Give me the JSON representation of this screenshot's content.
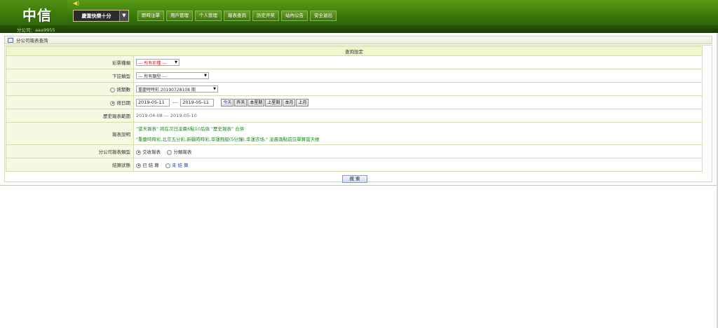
{
  "header": {
    "logo": "中信",
    "lottery_selector": "慶重快樂十分",
    "nav": [
      "即時注單",
      "用戶管理",
      "个人管理",
      "報表查詢",
      "历史开奖",
      "站內公告",
      "安全退出"
    ]
  },
  "subbar": {
    "branch_label": "分公司：aaa9955"
  },
  "panel": {
    "title": "分公司報表查詢",
    "header": "查詢設定",
    "rows": {
      "lottery_type": {
        "label": "彩票種類",
        "value": "--- 所有彩種 ---"
      },
      "bet_type": {
        "label": "下註類型",
        "value": "--- 所有類型 ---"
      },
      "by_period": {
        "label": "按期數",
        "value": "重慶時時彩    20190728108 期"
      },
      "by_date": {
        "label": "按日期",
        "start": "2019-05-11",
        "sep": "---",
        "end": "2019-05-11",
        "buttons": [
          "今天",
          "昨天",
          "本星期",
          "上星期",
          "本月",
          "上月"
        ]
      },
      "history_range": {
        "label": "歷史報表範圍",
        "value": "2019-04-08 --- 2019-05-10"
      },
      "report_note": {
        "label": "報表說明",
        "line1": "\"當天報表\" 將在次日凌晨6點10后與 \"歷史報表\" 合併",
        "line2": "\"重慶時時彩,北京五分彩,新疆時時彩,幸運飛艇(5分鐘),幸運农场,\" 凌晨兩點前註單算當天帳"
      },
      "report_type": {
        "label": "分公司報表類型",
        "options": [
          "交收報表",
          "分類報表"
        ]
      },
      "settle_status": {
        "label": "結算狀態",
        "options": [
          "已 結 算",
          "未 結 算"
        ]
      }
    },
    "search_button": "搜 索"
  }
}
